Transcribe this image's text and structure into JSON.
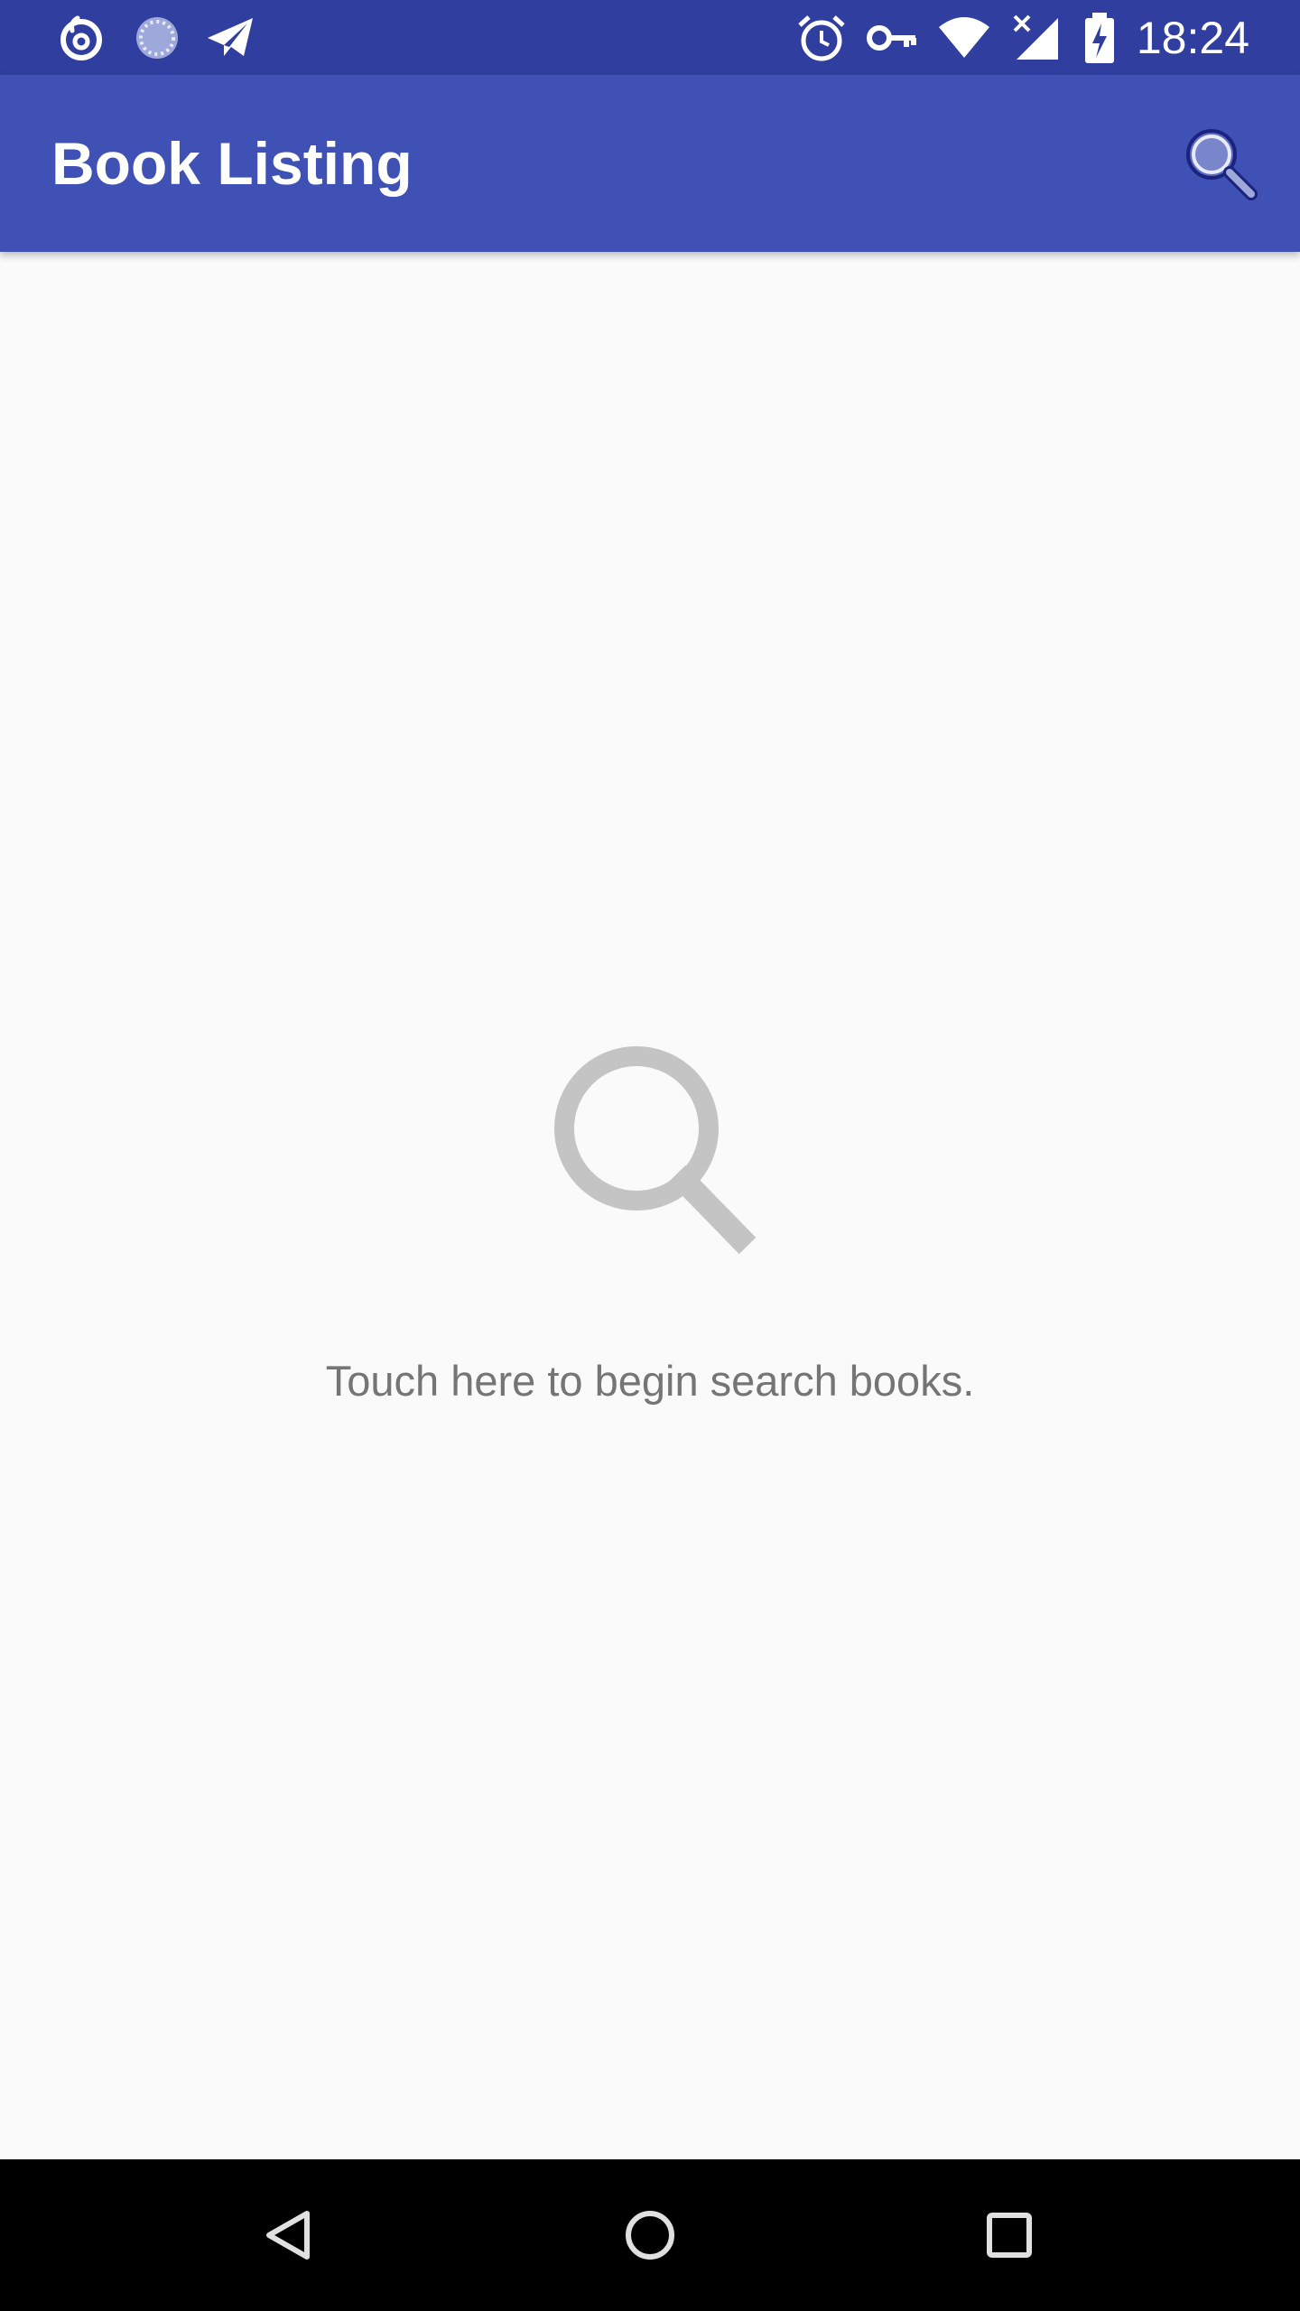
{
  "status_bar": {
    "time": "18:24",
    "left_icons": [
      "netease-music-icon",
      "loading-circle-icon",
      "telegram-icon"
    ],
    "right_icons": [
      "alarm-icon",
      "vpn-key-icon",
      "wifi-icon",
      "no-signal-icon",
      "battery-charging-icon"
    ],
    "background": "#303f9f"
  },
  "app_bar": {
    "title": "Book Listing",
    "action_icon": "search-icon",
    "background": "#3f51b5"
  },
  "empty_state": {
    "icon": "search-icon",
    "message": "Touch here to begin search books."
  },
  "nav_bar": {
    "buttons": [
      "back-icon",
      "home-icon",
      "recents-icon"
    ]
  }
}
